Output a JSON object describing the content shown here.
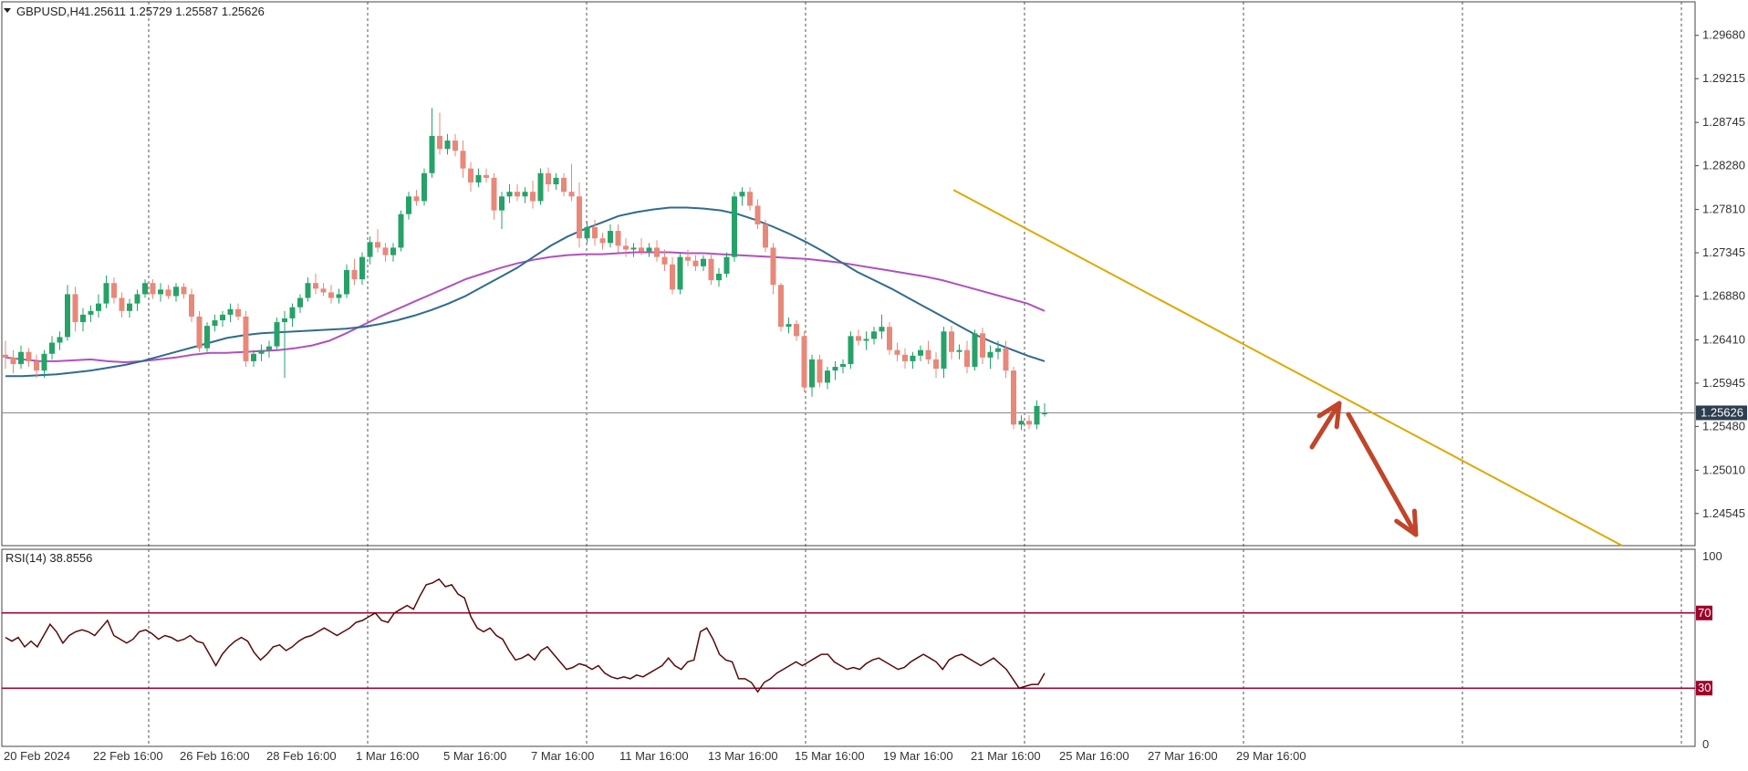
{
  "header": {
    "symbol": "GBPUSD,H4",
    "ohlc": "1.25611 1.25729 1.25587 1.25626"
  },
  "rsi_label": "RSI(14) 38.8556",
  "current_price_label": "1.25626",
  "colors": {
    "bull": "#26a269",
    "bear": "#e8887a",
    "ma_fast": "#2f6b8f",
    "ma_slow": "#b050c0",
    "trendline": "#e0a800",
    "arrow": "#c0452a",
    "rsi_line": "#5a0a0a",
    "rsi_levels": "#a0002a",
    "grid": "#555555",
    "price_tag_bg": "#2d3e50"
  },
  "chart_data": [
    {
      "type": "candlestick",
      "symbol": "GBPUSD",
      "timeframe": "H4",
      "y_ticks": [
        "1.29680",
        "1.29215",
        "1.28745",
        "1.28280",
        "1.27810",
        "1.27345",
        "1.26880",
        "1.26410",
        "1.25945",
        "1.25480",
        "1.25010",
        "1.24545"
      ],
      "ylim": [
        1.242,
        1.3004
      ],
      "x_tick_labels": [
        "20 Feb 2024",
        "22 Feb 16:00",
        "26 Feb 16:00",
        "28 Feb 16:00",
        "1 Mar 16:00",
        "5 Mar 16:00",
        "7 Mar 16:00",
        "11 Mar 16:00",
        "13 Mar 16:00",
        "15 Mar 16:00",
        "19 Mar 16:00",
        "21 Mar 16:00",
        "25 Mar 16:00",
        "27 Mar 16:00",
        "29 Mar 16:00"
      ],
      "current_price": 1.25626,
      "candles_ohlc": [
        [
          1.2625,
          1.264,
          1.261,
          1.2622
        ],
        [
          1.2622,
          1.263,
          1.2605,
          1.2615
        ],
        [
          1.2615,
          1.2635,
          1.261,
          1.2628
        ],
        [
          1.2628,
          1.2632,
          1.2612,
          1.2618
        ],
        [
          1.2618,
          1.2625,
          1.26,
          1.2608
        ],
        [
          1.2608,
          1.263,
          1.26,
          1.2626
        ],
        [
          1.2626,
          1.2645,
          1.262,
          1.2638
        ],
        [
          1.2638,
          1.265,
          1.263,
          1.2644
        ],
        [
          1.2644,
          1.27,
          1.264,
          1.269
        ],
        [
          1.269,
          1.2698,
          1.265,
          1.266
        ],
        [
          1.266,
          1.2675,
          1.265,
          1.2668
        ],
        [
          1.2668,
          1.2678,
          1.266,
          1.2672
        ],
        [
          1.2672,
          1.269,
          1.2665,
          1.268
        ],
        [
          1.268,
          1.271,
          1.2675,
          1.2702
        ],
        [
          1.2702,
          1.2708,
          1.268,
          1.2686
        ],
        [
          1.2686,
          1.2692,
          1.2665,
          1.2672
        ],
        [
          1.2672,
          1.2685,
          1.2665,
          1.268
        ],
        [
          1.268,
          1.2695,
          1.2672,
          1.269
        ],
        [
          1.269,
          1.2706,
          1.2686,
          1.2702
        ],
        [
          1.2702,
          1.2706,
          1.2685,
          1.269
        ],
        [
          1.269,
          1.2702,
          1.2682,
          1.2695
        ],
        [
          1.2695,
          1.27,
          1.2685,
          1.2688
        ],
        [
          1.2688,
          1.2702,
          1.2682,
          1.2698
        ],
        [
          1.2698,
          1.2702,
          1.2685,
          1.269
        ],
        [
          1.269,
          1.2696,
          1.266,
          1.2666
        ],
        [
          1.2666,
          1.2672,
          1.2628,
          1.2632
        ],
        [
          1.2632,
          1.266,
          1.2628,
          1.2656
        ],
        [
          1.2656,
          1.2668,
          1.265,
          1.2662
        ],
        [
          1.2662,
          1.2672,
          1.2655,
          1.2668
        ],
        [
          1.2668,
          1.268,
          1.266,
          1.2674
        ],
        [
          1.2674,
          1.268,
          1.2662,
          1.2666
        ],
        [
          1.2666,
          1.2672,
          1.2612,
          1.2618
        ],
        [
          1.2618,
          1.263,
          1.2612,
          1.2626
        ],
        [
          1.2626,
          1.2636,
          1.2618,
          1.263
        ],
        [
          1.263,
          1.264,
          1.2622,
          1.2634
        ],
        [
          1.2634,
          1.2665,
          1.263,
          1.266
        ],
        [
          1.266,
          1.2672,
          1.26,
          1.2664
        ],
        [
          1.2664,
          1.268,
          1.2655,
          1.2676
        ],
        [
          1.2676,
          1.269,
          1.267,
          1.2686
        ],
        [
          1.2686,
          1.2708,
          1.2682,
          1.2702
        ],
        [
          1.2702,
          1.2712,
          1.269,
          1.2696
        ],
        [
          1.2696,
          1.2702,
          1.2688,
          1.2692
        ],
        [
          1.2692,
          1.27,
          1.268,
          1.2686
        ],
        [
          1.2686,
          1.2696,
          1.268,
          1.269
        ],
        [
          1.269,
          1.2722,
          1.2686,
          1.2716
        ],
        [
          1.2716,
          1.2728,
          1.27,
          1.2706
        ],
        [
          1.2706,
          1.2735,
          1.27,
          1.273
        ],
        [
          1.273,
          1.2752,
          1.2722,
          1.2746
        ],
        [
          1.2746,
          1.276,
          1.2735,
          1.274
        ],
        [
          1.274,
          1.2745,
          1.2725,
          1.2732
        ],
        [
          1.2732,
          1.2745,
          1.2725,
          1.274
        ],
        [
          1.274,
          1.278,
          1.2736,
          1.2776
        ],
        [
          1.2776,
          1.28,
          1.277,
          1.2795
        ],
        [
          1.2795,
          1.2802,
          1.2785,
          1.279
        ],
        [
          1.279,
          1.2825,
          1.2785,
          1.282
        ],
        [
          1.282,
          1.289,
          1.2815,
          1.286
        ],
        [
          1.286,
          1.2885,
          1.284,
          1.2846
        ],
        [
          1.2846,
          1.2862,
          1.284,
          1.2855
        ],
        [
          1.2855,
          1.2862,
          1.2838,
          1.2844
        ],
        [
          1.2844,
          1.2855,
          1.2815,
          1.2825
        ],
        [
          1.2825,
          1.2832,
          1.28,
          1.281
        ],
        [
          1.281,
          1.2825,
          1.2805,
          1.2818
        ],
        [
          1.2818,
          1.2825,
          1.281,
          1.2815
        ],
        [
          1.2815,
          1.282,
          1.277,
          1.278
        ],
        [
          1.278,
          1.28,
          1.276,
          1.2795
        ],
        [
          1.2795,
          1.2808,
          1.2788,
          1.28
        ],
        [
          1.28,
          1.2808,
          1.279,
          1.2795
        ],
        [
          1.2795,
          1.2805,
          1.2788,
          1.28
        ],
        [
          1.28,
          1.2812,
          1.2782,
          1.279
        ],
        [
          1.279,
          1.2825,
          1.2786,
          1.282
        ],
        [
          1.282,
          1.2826,
          1.28,
          1.2808
        ],
        [
          1.2808,
          1.282,
          1.2802,
          1.2815
        ],
        [
          1.2815,
          1.282,
          1.2795,
          1.28
        ],
        [
          1.28,
          1.283,
          1.279,
          1.2795
        ],
        [
          1.2795,
          1.281,
          1.274,
          1.275
        ],
        [
          1.275,
          1.2768,
          1.2745,
          1.2762
        ],
        [
          1.2762,
          1.277,
          1.2742,
          1.275
        ],
        [
          1.275,
          1.2756,
          1.2738,
          1.2745
        ],
        [
          1.2745,
          1.2765,
          1.274,
          1.2758
        ],
        [
          1.2758,
          1.2765,
          1.2735,
          1.2742
        ],
        [
          1.2742,
          1.275,
          1.273,
          1.2738
        ],
        [
          1.2738,
          1.2745,
          1.273,
          1.274
        ],
        [
          1.274,
          1.275,
          1.2732,
          1.2736
        ],
        [
          1.2736,
          1.2745,
          1.273,
          1.274
        ],
        [
          1.274,
          1.2748,
          1.2725,
          1.273
        ],
        [
          1.273,
          1.2738,
          1.2715,
          1.2722
        ],
        [
          1.2722,
          1.273,
          1.269,
          1.2695
        ],
        [
          1.2695,
          1.2735,
          1.269,
          1.273
        ],
        [
          1.273,
          1.2738,
          1.272,
          1.2726
        ],
        [
          1.2726,
          1.2732,
          1.2715,
          1.272
        ],
        [
          1.272,
          1.2732,
          1.2715,
          1.2728
        ],
        [
          1.2728,
          1.2735,
          1.27,
          1.2705
        ],
        [
          1.2705,
          1.2718,
          1.2698,
          1.2712
        ],
        [
          1.2712,
          1.2735,
          1.2708,
          1.273
        ],
        [
          1.273,
          1.28,
          1.2725,
          1.2795
        ],
        [
          1.2795,
          1.2805,
          1.2785,
          1.28
        ],
        [
          1.28,
          1.2805,
          1.278,
          1.2785
        ],
        [
          1.2785,
          1.2792,
          1.276,
          1.2765
        ],
        [
          1.2765,
          1.277,
          1.2735,
          1.274
        ],
        [
          1.274,
          1.2745,
          1.269,
          1.27
        ],
        [
          1.27,
          1.2702,
          1.265,
          1.2655
        ],
        [
          1.2655,
          1.2665,
          1.2648,
          1.2658
        ],
        [
          1.2658,
          1.2662,
          1.264,
          1.2645
        ],
        [
          1.2645,
          1.265,
          1.2585,
          1.259
        ],
        [
          1.259,
          1.2625,
          1.258,
          1.262
        ],
        [
          1.262,
          1.2625,
          1.259,
          1.2595
        ],
        [
          1.2595,
          1.2612,
          1.2588,
          1.2608
        ],
        [
          1.2608,
          1.2618,
          1.2598,
          1.2612
        ],
        [
          1.2612,
          1.262,
          1.2605,
          1.2615
        ],
        [
          1.2615,
          1.265,
          1.261,
          1.2645
        ],
        [
          1.2645,
          1.2652,
          1.2635,
          1.264
        ],
        [
          1.264,
          1.265,
          1.263,
          1.2642
        ],
        [
          1.2642,
          1.2655,
          1.2636,
          1.265
        ],
        [
          1.265,
          1.2668,
          1.2642,
          1.2655
        ],
        [
          1.2655,
          1.266,
          1.2625,
          1.263
        ],
        [
          1.263,
          1.2638,
          1.2618,
          1.2625
        ],
        [
          1.2625,
          1.2632,
          1.261,
          1.2618
        ],
        [
          1.2618,
          1.2628,
          1.261,
          1.2624
        ],
        [
          1.2624,
          1.2635,
          1.2618,
          1.263
        ],
        [
          1.263,
          1.264,
          1.2615,
          1.262
        ],
        [
          1.262,
          1.2628,
          1.26,
          1.261
        ],
        [
          1.261,
          1.2655,
          1.26,
          1.265
        ],
        [
          1.265,
          1.2656,
          1.262,
          1.2628
        ],
        [
          1.2628,
          1.2636,
          1.262,
          1.263
        ],
        [
          1.263,
          1.264,
          1.2605,
          1.2612
        ],
        [
          1.2612,
          1.2652,
          1.2608,
          1.2648
        ],
        [
          1.2648,
          1.2654,
          1.2615,
          1.2622
        ],
        [
          1.2622,
          1.2635,
          1.261,
          1.2628
        ],
        [
          1.2628,
          1.264,
          1.262,
          1.2632
        ],
        [
          1.2632,
          1.264,
          1.26,
          1.2608
        ],
        [
          1.2608,
          1.2612,
          1.2545,
          1.255
        ],
        [
          1.255,
          1.256,
          1.2544,
          1.2554
        ],
        [
          1.2554,
          1.256,
          1.2545,
          1.255
        ],
        [
          1.255,
          1.2576,
          1.2545,
          1.257
        ],
        [
          1.25611,
          1.25729,
          1.25587,
          1.25626
        ]
      ],
      "ma_fast": [
        1.2602,
        1.2602,
        1.2603,
        1.2604,
        1.2606,
        1.2608,
        1.2611,
        1.2614,
        1.2618,
        1.2623,
        1.2628,
        1.2633,
        1.2638,
        1.2643,
        1.2646,
        1.2648,
        1.2649,
        1.265,
        1.2651,
        1.2652,
        1.2653,
        1.2655,
        1.2658,
        1.2662,
        1.2667,
        1.2673,
        1.268,
        1.2688,
        1.2698,
        1.2708,
        1.2718,
        1.273,
        1.2742,
        1.2752,
        1.276,
        1.2767,
        1.2774,
        1.2778,
        1.2781,
        1.2783,
        1.2783,
        1.2782,
        1.278,
        1.2776,
        1.277,
        1.2763,
        1.2755,
        1.2746,
        1.2736,
        1.2725,
        1.2714,
        1.2705,
        1.2696,
        1.2686,
        1.2676,
        1.2666,
        1.2656,
        1.2646,
        1.2638,
        1.2631,
        1.2624,
        1.2618
      ],
      "ma_slow": [
        1.2622,
        1.262,
        1.2618,
        1.2618,
        1.2619,
        1.262,
        1.2618,
        1.2617,
        1.2618,
        1.262,
        1.2622,
        1.2625,
        1.2627,
        1.2627,
        1.2628,
        1.2629,
        1.263,
        1.2632,
        1.2635,
        1.264,
        1.2648,
        1.2657,
        1.2666,
        1.2674,
        1.2682,
        1.269,
        1.2698,
        1.2706,
        1.2712,
        1.2718,
        1.2723,
        1.2727,
        1.273,
        1.2732,
        1.2733,
        1.2733,
        1.2734,
        1.2735,
        1.2735,
        1.2735,
        1.2734,
        1.2734,
        1.2733,
        1.2732,
        1.2731,
        1.273,
        1.2729,
        1.2728,
        1.2726,
        1.2724,
        1.2721,
        1.2718,
        1.2715,
        1.2712,
        1.2709,
        1.2705,
        1.27,
        1.2695,
        1.269,
        1.2685,
        1.268,
        1.2672
      ]
    },
    {
      "type": "line",
      "indicator": "RSI(14)",
      "y_ticks": [
        "100",
        "70",
        "30",
        "0"
      ],
      "levels": [
        70,
        30
      ],
      "ylim": [
        0,
        100
      ],
      "values": [
        57,
        55,
        57,
        52,
        55,
        52,
        58,
        64,
        60,
        54,
        58,
        60,
        61,
        60,
        58,
        62,
        66,
        58,
        56,
        54,
        56,
        60,
        61,
        59,
        56,
        58,
        57,
        55,
        56,
        58,
        55,
        54,
        48,
        42,
        48,
        52,
        55,
        57,
        55,
        49,
        45,
        48,
        52,
        53,
        50,
        52,
        55,
        57,
        58,
        60,
        62,
        60,
        58,
        60,
        62,
        65,
        66,
        68,
        70,
        66,
        65,
        70,
        72,
        74,
        72,
        79,
        85,
        86,
        88,
        84,
        85,
        80,
        78,
        68,
        62,
        60,
        62,
        58,
        56,
        50,
        45,
        46,
        48,
        45,
        50,
        52,
        48,
        44,
        40,
        41,
        43,
        42,
        40,
        42,
        38,
        36,
        35,
        36,
        35,
        37,
        36,
        38,
        40,
        42,
        46,
        42,
        40,
        44,
        45,
        60,
        62,
        56,
        48,
        45,
        44,
        35,
        35,
        33,
        28,
        33,
        35,
        38,
        40,
        42,
        44,
        42,
        44,
        46,
        48,
        48,
        44,
        42,
        40,
        41,
        40,
        43,
        45,
        46,
        44,
        42,
        40,
        41,
        44,
        46,
        48,
        46,
        44,
        40,
        45,
        47,
        48,
        46,
        44,
        42,
        44,
        46,
        43,
        40,
        35,
        30,
        31,
        32,
        32,
        38
      ]
    }
  ]
}
